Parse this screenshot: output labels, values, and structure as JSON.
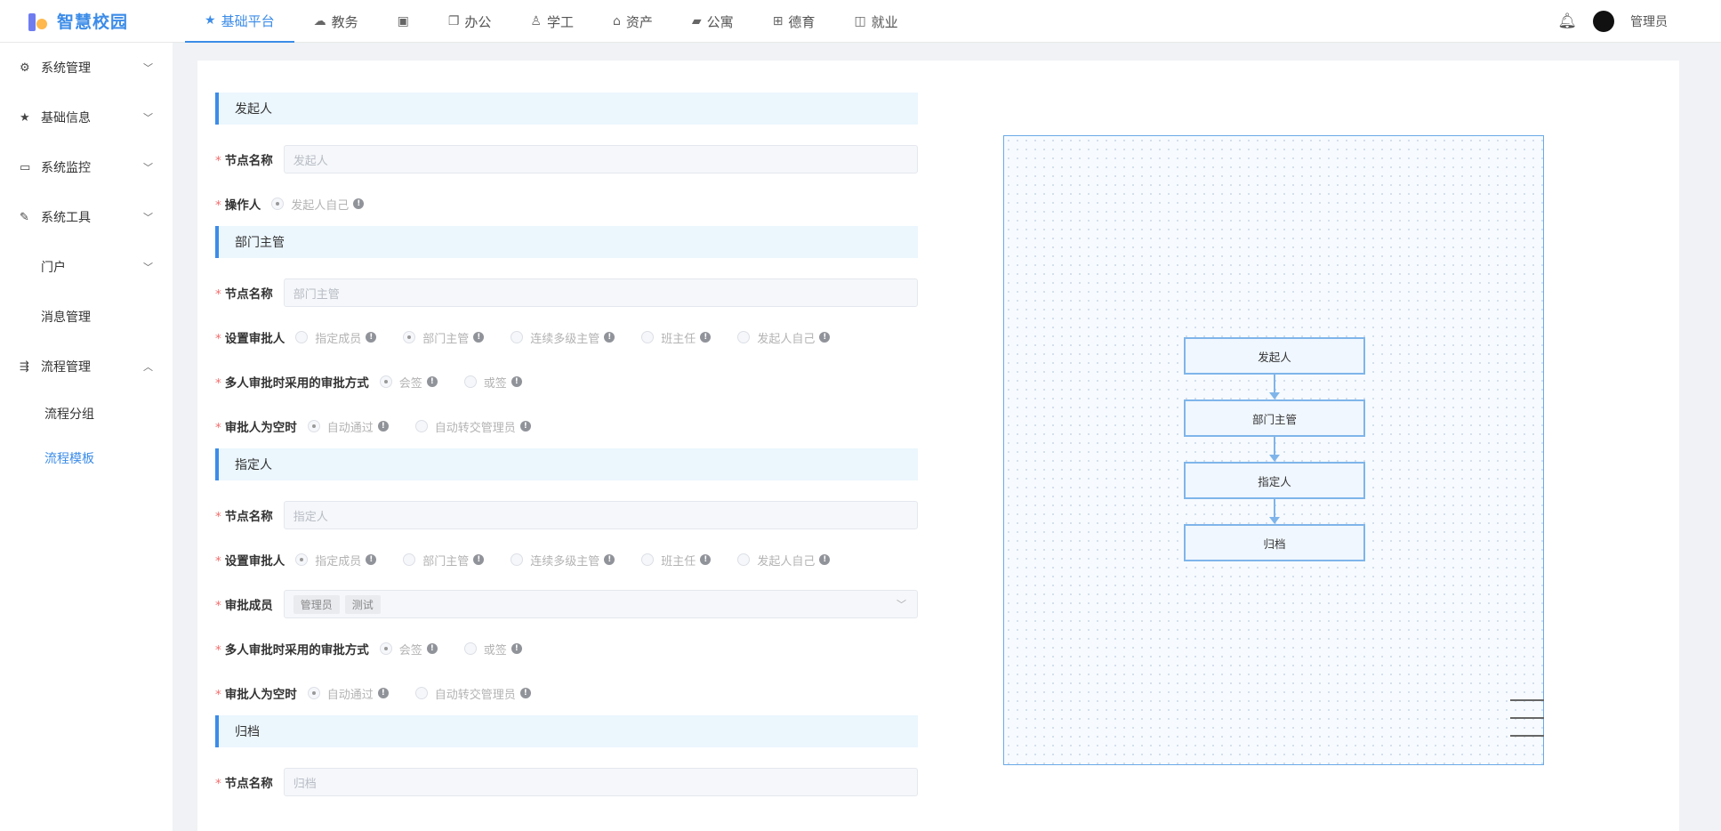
{
  "app": {
    "logo_text": "智慧校园"
  },
  "topnav": {
    "items": [
      {
        "label": "基础平台",
        "icon": "star-icon",
        "active": true
      },
      {
        "label": "教务",
        "icon": "cloud-icon"
      },
      {
        "label": "",
        "icon": "book-icon"
      },
      {
        "label": "办公",
        "icon": "copy-icon"
      },
      {
        "label": "学工",
        "icon": "user-tie-icon"
      },
      {
        "label": "资产",
        "icon": "home-icon"
      },
      {
        "label": "公寓",
        "icon": "folder-icon"
      },
      {
        "label": "德育",
        "icon": "grid-icon"
      },
      {
        "label": "就业",
        "icon": "briefcase-icon"
      }
    ],
    "username": "管理员"
  },
  "sidebar": {
    "items": [
      {
        "label": "系统管理",
        "icon": "gear-icon",
        "expandable": true,
        "expanded": false
      },
      {
        "label": "基础信息",
        "icon": "star-icon",
        "expandable": true,
        "expanded": false
      },
      {
        "label": "系统监控",
        "icon": "monitor-icon",
        "expandable": true,
        "expanded": false
      },
      {
        "label": "系统工具",
        "icon": "tool-icon",
        "expandable": true,
        "expanded": false
      },
      {
        "label": "门户",
        "icon": "",
        "expandable": true,
        "expanded": false
      },
      {
        "label": "消息管理",
        "icon": "",
        "expandable": false
      },
      {
        "label": "流程管理",
        "icon": "flow-icon",
        "expandable": true,
        "expanded": true
      }
    ],
    "subitems": [
      {
        "label": "流程分组",
        "active": false
      },
      {
        "label": "流程模板",
        "active": true
      }
    ]
  },
  "form": {
    "sections": [
      {
        "title": "发起人",
        "node_name_label": "节点名称",
        "node_name_placeholder": "发起人",
        "operator_label": "操作人",
        "operator_options": [
          {
            "label": "发起人自己",
            "checked": true
          }
        ]
      },
      {
        "title": "部门主管",
        "node_name_label": "节点名称",
        "node_name_placeholder": "部门主管",
        "approver_label": "设置审批人",
        "approver_options": [
          {
            "label": "指定成员",
            "checked": false
          },
          {
            "label": "部门主管",
            "checked": true
          },
          {
            "label": "连续多级主管",
            "checked": false
          },
          {
            "label": "班主任",
            "checked": false
          },
          {
            "label": "发起人自己",
            "checked": false
          }
        ],
        "multi_label": "多人审批时采用的审批方式",
        "multi_options": [
          {
            "label": "会签",
            "checked": true
          },
          {
            "label": "或签",
            "checked": false
          }
        ],
        "empty_label": "审批人为空时",
        "empty_options": [
          {
            "label": "自动通过",
            "checked": true
          },
          {
            "label": "自动转交管理员",
            "checked": false
          }
        ]
      },
      {
        "title": "指定人",
        "node_name_label": "节点名称",
        "node_name_placeholder": "指定人",
        "approver_label": "设置审批人",
        "approver_options": [
          {
            "label": "指定成员",
            "checked": true
          },
          {
            "label": "部门主管",
            "checked": false
          },
          {
            "label": "连续多级主管",
            "checked": false
          },
          {
            "label": "班主任",
            "checked": false
          },
          {
            "label": "发起人自己",
            "checked": false
          }
        ],
        "members_label": "审批成员",
        "members": [
          "管理员",
          "测试"
        ],
        "multi_label": "多人审批时采用的审批方式",
        "multi_options": [
          {
            "label": "会签",
            "checked": true
          },
          {
            "label": "或签",
            "checked": false
          }
        ],
        "empty_label": "审批人为空时",
        "empty_options": [
          {
            "label": "自动通过",
            "checked": true
          },
          {
            "label": "自动转交管理员",
            "checked": false
          }
        ]
      },
      {
        "title": "归档",
        "node_name_label": "节点名称",
        "node_name_placeholder": "归档"
      }
    ]
  },
  "flow": {
    "nodes": [
      "发起人",
      "部门主管",
      "指定人",
      "归档"
    ]
  },
  "colors": {
    "accent": "#3c8ce8",
    "required": "#f56c6c",
    "section_bg": "#ebf6fd",
    "node_border": "#7fb5ea"
  }
}
